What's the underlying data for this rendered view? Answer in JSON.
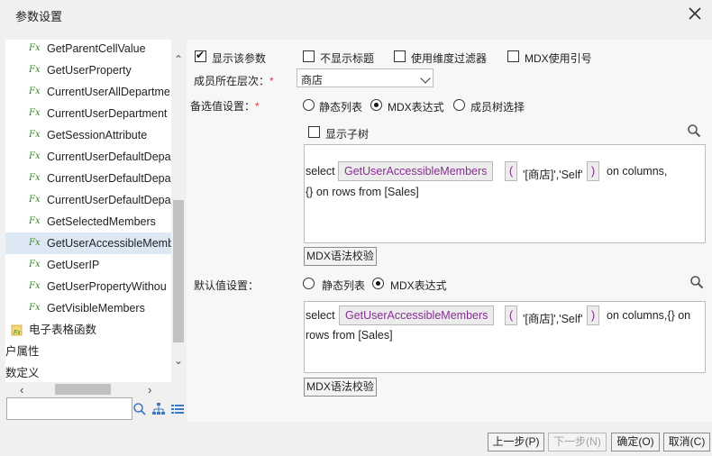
{
  "dialog": {
    "title": "参数设置"
  },
  "tree": {
    "items": [
      {
        "label": "GetParentCellValue",
        "icon": "function-icon"
      },
      {
        "label": "GetUserProperty",
        "icon": "function-icon"
      },
      {
        "label": "CurrentUserAllDepartme",
        "icon": "function-icon"
      },
      {
        "label": "CurrentUserDepartment",
        "icon": "function-icon"
      },
      {
        "label": "GetSessionAttribute",
        "icon": "function-icon"
      },
      {
        "label": "CurrentUserDefaultDepa",
        "icon": "function-icon"
      },
      {
        "label": "CurrentUserDefaultDepa",
        "icon": "function-icon"
      },
      {
        "label": "CurrentUserDefaultDepa",
        "icon": "function-icon"
      },
      {
        "label": "GetSelectedMembers",
        "icon": "function-icon"
      },
      {
        "label": "GetUserAccessibleMemb",
        "icon": "function-icon"
      },
      {
        "label": "GetUserIP",
        "icon": "function-icon"
      },
      {
        "label": "GetUserPropertyWithou",
        "icon": "function-icon"
      },
      {
        "label": "GetVisibleMembers",
        "icon": "function-icon"
      }
    ],
    "folder_label": "电子表格函数",
    "extra1": "户属性",
    "extra2": "数定义",
    "search_placeholder": ""
  },
  "options": {
    "show_param": "显示该参数",
    "hide_title": "不显示标题",
    "use_dim_filter": "使用维度过滤器",
    "mdx_quote": "MDX使用引号"
  },
  "level": {
    "label": "成员所在层次：",
    "value": "商店"
  },
  "candidate": {
    "label": "备选值设置：",
    "static_list": "静态列表",
    "mdx_expr": "MDX表达式",
    "member_tree": "成员树选择",
    "show_subtree": "显示子树",
    "expr": {
      "prefix": "select",
      "func": "GetUserAccessibleMembers",
      "open": "(",
      "args": "'[商店]','Self'",
      "close": ")",
      "suffix": "on columns,",
      "line2": "{} on rows from [Sales]"
    },
    "validate_btn": "MDX语法校验"
  },
  "default": {
    "label": "默认值设置：",
    "static_list": "静态列表",
    "mdx_expr": "MDX表达式",
    "expr": {
      "prefix": "select",
      "func": "GetUserAccessibleMembers",
      "open": "(",
      "args": "'[商店]','Self'",
      "close": ")",
      "suffix": "on columns,{} on",
      "line2": "rows from [Sales]"
    },
    "validate_btn": "MDX语法校验"
  },
  "footer": {
    "prev": "上一步(P)",
    "next": "下一步(N)",
    "ok": "确定(O)",
    "cancel": "取消(C)"
  }
}
